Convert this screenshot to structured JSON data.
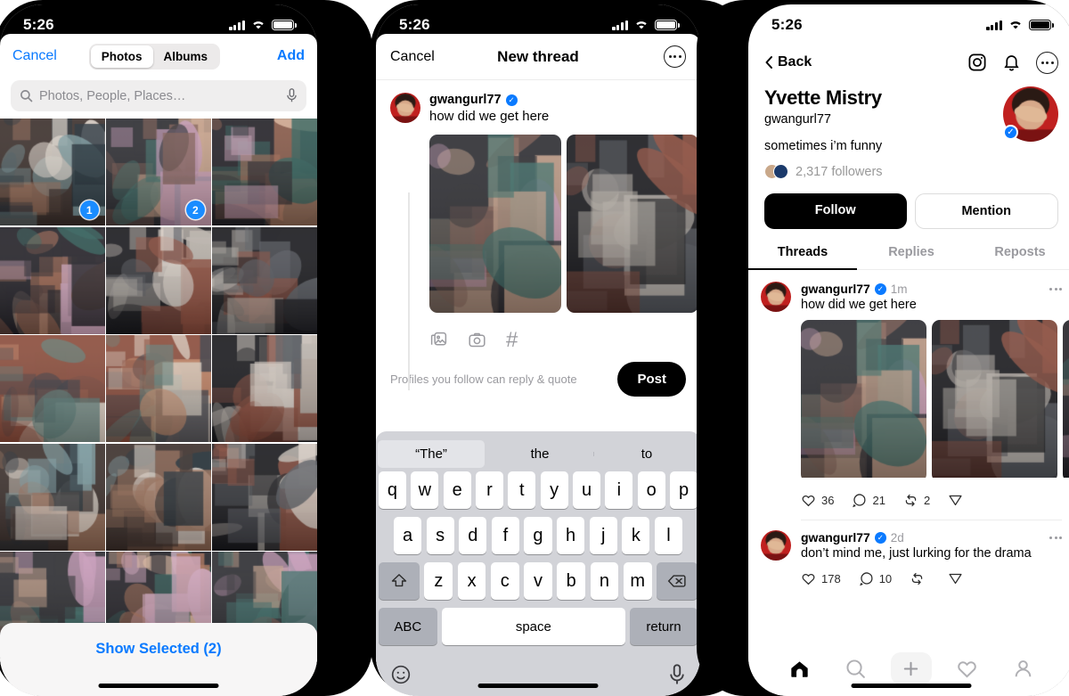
{
  "status_bar": {
    "time": "5:26",
    "signal_icon": "cellular-bars-icon",
    "wifi_icon": "wifi-icon",
    "battery_icon": "battery-full-icon"
  },
  "phone1": {
    "name": "photo-picker",
    "nav": {
      "cancel": "Cancel",
      "add": "Add"
    },
    "segments": [
      {
        "label": "Photos",
        "selected": true
      },
      {
        "label": "Albums",
        "selected": false
      }
    ],
    "search": {
      "placeholder": "Photos, People, Places…",
      "icon": "search-icon",
      "mic_icon": "microphone-icon"
    },
    "selected_badges": [
      {
        "cell": 0,
        "number": "1"
      },
      {
        "cell": 1,
        "number": "2"
      }
    ],
    "footer": {
      "label": "Show Selected (2)"
    },
    "grid_cells": 15
  },
  "phone2": {
    "name": "new-thread-composer",
    "nav": {
      "cancel": "Cancel",
      "title": "New thread",
      "more_icon": "more-circle-icon"
    },
    "author": {
      "username": "gwangurl77",
      "verified": true
    },
    "text": "how did we get here",
    "attachments": 3,
    "tools": [
      "photo-library-icon",
      "camera-icon",
      "hashtag-icon"
    ],
    "footer": {
      "reply_policy": "Profiles you follow can reply & quote",
      "post_label": "Post"
    },
    "keyboard": {
      "suggestions": [
        "“The”",
        "the",
        "to"
      ],
      "row1": [
        "q",
        "w",
        "e",
        "r",
        "t",
        "y",
        "u",
        "i",
        "o",
        "p"
      ],
      "row2": [
        "a",
        "s",
        "d",
        "f",
        "g",
        "h",
        "j",
        "k",
        "l"
      ],
      "row3": [
        "z",
        "x",
        "c",
        "v",
        "b",
        "n",
        "m"
      ],
      "shift_icon": "shift-up-icon",
      "backspace_icon": "backspace-icon",
      "abc": "ABC",
      "space": "space",
      "return": "return",
      "emoji_icon": "emoji-smiley-icon",
      "dictation_icon": "microphone-icon"
    }
  },
  "phone3": {
    "name": "profile",
    "nav": {
      "back": "Back",
      "back_icon": "chevron-left-icon",
      "instagram_icon": "instagram-icon",
      "bell_icon": "bell-icon",
      "more_icon": "more-circle-icon"
    },
    "profile": {
      "display_name": "Yvette Mistry",
      "handle": "gwangurl77",
      "bio": "sometimes i’m funny",
      "followers": "2,317 followers",
      "verified": true
    },
    "buttons": {
      "follow": "Follow",
      "mention": "Mention"
    },
    "tabs": [
      {
        "label": "Threads",
        "selected": true
      },
      {
        "label": "Replies",
        "selected": false
      },
      {
        "label": "Reposts",
        "selected": false
      }
    ],
    "posts": [
      {
        "username": "gwangurl77",
        "verified": true,
        "time": "1m",
        "text": "how did we get here",
        "has_media": true,
        "likes": "36",
        "replies": "21",
        "reposts": "2",
        "like_icon": "heart-icon",
        "reply_icon": "comment-icon",
        "repost_icon": "repost-icon",
        "share_icon": "share-paperplane-icon"
      },
      {
        "username": "gwangurl77",
        "verified": true,
        "time": "2d",
        "text": "don’t mind me, just lurking for the drama",
        "has_media": false,
        "likes": "178",
        "replies": "10",
        "reposts": "",
        "like_icon": "heart-icon",
        "reply_icon": "comment-icon",
        "repost_icon": "repost-icon",
        "share_icon": "share-paperplane-icon"
      }
    ],
    "tabbar": [
      {
        "name": "home",
        "icon": "home-icon",
        "active": true
      },
      {
        "name": "search",
        "icon": "search-icon",
        "active": false
      },
      {
        "name": "compose",
        "icon": "plus-icon",
        "active": false
      },
      {
        "name": "activity",
        "icon": "heart-icon",
        "active": false
      },
      {
        "name": "profile",
        "icon": "person-icon",
        "active": false
      }
    ]
  },
  "colors": {
    "accent_blue": "#0a7aff",
    "verified_blue": "#0a7aff",
    "black": "#000000",
    "muted": "#9a9a9f"
  }
}
